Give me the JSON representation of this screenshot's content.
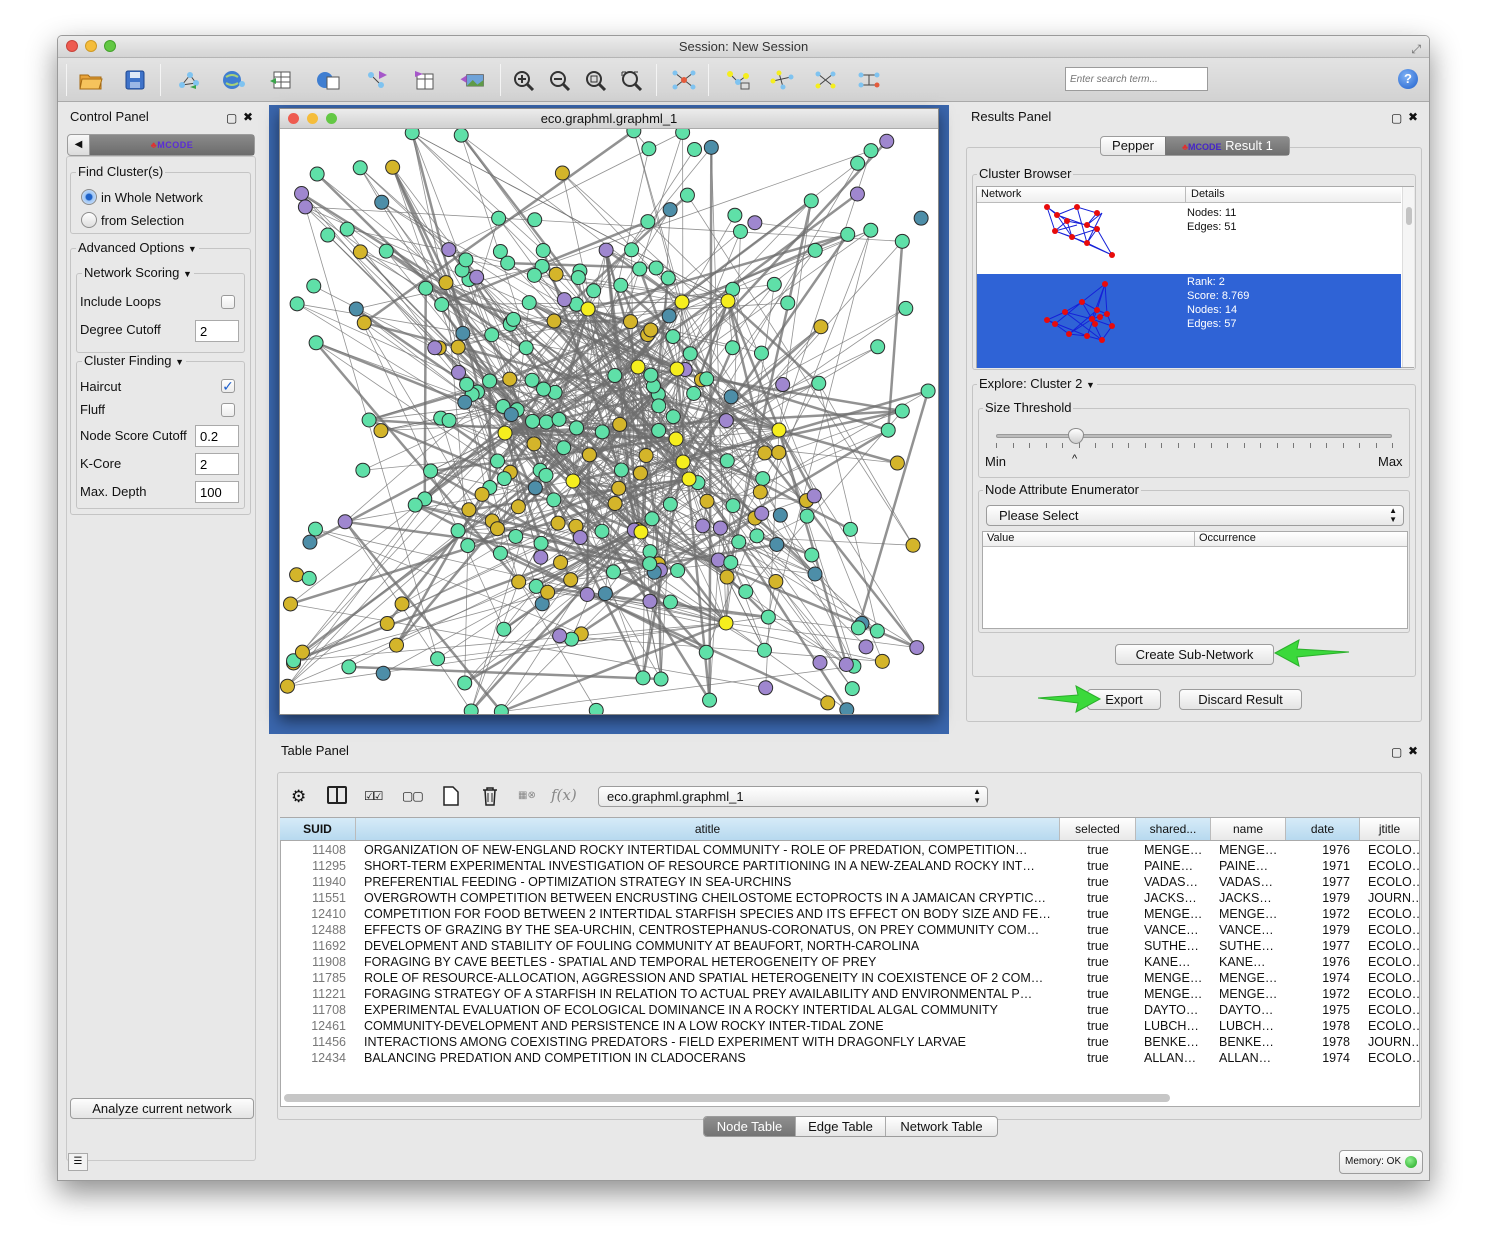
{
  "window": {
    "title": "Session: New Session"
  },
  "toolbar": {
    "search_placeholder": "Enter search term...",
    "help": "?"
  },
  "control_panel": {
    "title": "Control Panel",
    "tab_logo": "MCODE",
    "find_clusters": "Find Cluster(s)",
    "in_whole_network": "in Whole Network",
    "from_selection": "from Selection",
    "advanced_options": "Advanced Options",
    "network_scoring": "Network Scoring",
    "include_loops": "Include Loops",
    "degree_cutoff": "Degree Cutoff",
    "degree_cutoff_value": "2",
    "cluster_finding": "Cluster Finding",
    "haircut": "Haircut",
    "fluff": "Fluff",
    "node_score_cutoff": "Node Score Cutoff",
    "node_score_cutoff_value": "0.2",
    "k_core": "K-Core",
    "k_core_value": "2",
    "max_depth": "Max. Depth",
    "max_depth_value": "100",
    "analyze_button": "Analyze current network"
  },
  "network_view": {
    "title": "eco.graphml.graphml_1"
  },
  "results_panel": {
    "title": "Results Panel",
    "tab_pepper": "Pepper",
    "tab_result": "Result 1",
    "tab_result_logo": "MCODE",
    "cluster_browser": "Cluster Browser",
    "col_network": "Network",
    "col_details": "Details",
    "cluster1": {
      "nodes": "Nodes: 11",
      "edges": "Edges: 51"
    },
    "cluster2": {
      "rank": "Rank: 2",
      "score": "Score: 8.769",
      "nodes": "Nodes: 14",
      "edges": "Edges: 57"
    },
    "explore": "Explore: Cluster 2",
    "size_threshold": "Size Threshold",
    "min": "Min",
    "max": "Max",
    "slider_caret": "^",
    "node_attr_enum": "Node Attribute Enumerator",
    "please_select": "Please Select",
    "col_value": "Value",
    "col_occurrence": "Occurrence",
    "create_subnetwork": "Create Sub-Network",
    "export": "Export",
    "discard": "Discard Result"
  },
  "table_panel": {
    "title": "Table Panel",
    "fx": "f(x)",
    "table_select": "eco.graphml.graphml_1",
    "columns": [
      "SUID",
      "atitle",
      "selected",
      "shared...",
      "name",
      "date",
      "jtitle"
    ],
    "rows": [
      [
        "11408",
        "ORGANIZATION OF NEW-ENGLAND ROCKY INTERTIDAL COMMUNITY - ROLE OF PREDATION, COMPETITION…",
        "true",
        "MENGE…",
        "MENGE…",
        "1976",
        "ECOLO…"
      ],
      [
        "11295",
        "SHORT-TERM EXPERIMENTAL INVESTIGATION OF RESOURCE PARTITIONING IN A NEW-ZEALAND ROCKY INT…",
        "true",
        "PAINE…",
        "PAINE…",
        "1971",
        "ECOLO…"
      ],
      [
        "11940",
        "PREFERENTIAL FEEDING - OPTIMIZATION STRATEGY IN SEA-URCHINS",
        "true",
        "VADAS…",
        "VADAS…",
        "1977",
        "ECOLO…"
      ],
      [
        "11551",
        "OVERGROWTH COMPETITION BETWEEN ENCRUSTING CHEILOSTOME ECTOPROCTS IN A JAMAICAN CRYPTIC…",
        "true",
        "JACKS…",
        "JACKS…",
        "1979",
        "JOURN…"
      ],
      [
        "12410",
        "COMPETITION FOR FOOD BETWEEN 2 INTERTIDAL STARFISH SPECIES AND ITS EFFECT ON BODY SIZE AND FE…",
        "true",
        "MENGE…",
        "MENGE…",
        "1972",
        "ECOLO…"
      ],
      [
        "12488",
        "EFFECTS OF GRAZING BY THE SEA-URCHIN, CENTROSTEPHANUS-CORONATUS, ON PREY COMMUNITY COM…",
        "true",
        "VANCE…",
        "VANCE…",
        "1979",
        "ECOLO…"
      ],
      [
        "11692",
        "DEVELOPMENT AND STABILITY OF FOULING COMMUNITY AT BEAUFORT, NORTH-CAROLINA",
        "true",
        "SUTHE…",
        "SUTHE…",
        "1977",
        "ECOLO…"
      ],
      [
        "11908",
        "FORAGING BY CAVE BEETLES - SPATIAL AND TEMPORAL HETEROGENEITY OF PREY",
        "true",
        "KANE…",
        "KANE…",
        "1976",
        "ECOLO…"
      ],
      [
        "11785",
        "ROLE OF RESOURCE-ALLOCATION, AGGRESSION AND SPATIAL HETEROGENEITY IN COEXISTENCE OF 2 COM…",
        "true",
        "MENGE…",
        "MENGE…",
        "1974",
        "ECOLO…"
      ],
      [
        "11221",
        "FORAGING STRATEGY OF A STARFISH IN RELATION TO ACTUAL PREY AVAILABILITY AND ENVIRONMENTAL P…",
        "true",
        "MENGE…",
        "MENGE…",
        "1972",
        "ECOLO…"
      ],
      [
        "11708",
        "EXPERIMENTAL EVALUATION OF ECOLOGICAL DOMINANCE IN A ROCKY INTERTIDAL ALGAL COMMUNITY",
        "true",
        "DAYTO…",
        "DAYTO…",
        "1975",
        "ECOLO…"
      ],
      [
        "12461",
        "COMMUNITY-DEVELOPMENT AND PERSISTENCE IN A LOW ROCKY INTER-TIDAL ZONE",
        "true",
        "LUBCH…",
        "LUBCH…",
        "1978",
        "ECOLO…"
      ],
      [
        "11456",
        "INTERACTIONS AMONG COEXISTING PREDATORS - FIELD EXPERIMENT WITH DRAGONFLY LARVAE",
        "true",
        "BENKE…",
        "BENKE…",
        "1978",
        "JOURN…"
      ],
      [
        "12434",
        "BALANCING PREDATION AND COMPETITION IN CLADOCERANS",
        "true",
        "ALLAN…",
        "ALLAN…",
        "1974",
        "ECOLO…"
      ]
    ],
    "tabs": [
      "Node Table",
      "Edge Table",
      "Network Table"
    ]
  },
  "status": {
    "memory": "Memory: OK"
  },
  "colors": {
    "node_green": "#5fe0a8",
    "node_yellow": "#f5ee1e",
    "node_gold": "#d4b52a",
    "node_purple": "#9f87cf",
    "node_teal": "#4d8ea8",
    "edge": "#6e6e6e",
    "selection_blue": "#2f63d6"
  }
}
